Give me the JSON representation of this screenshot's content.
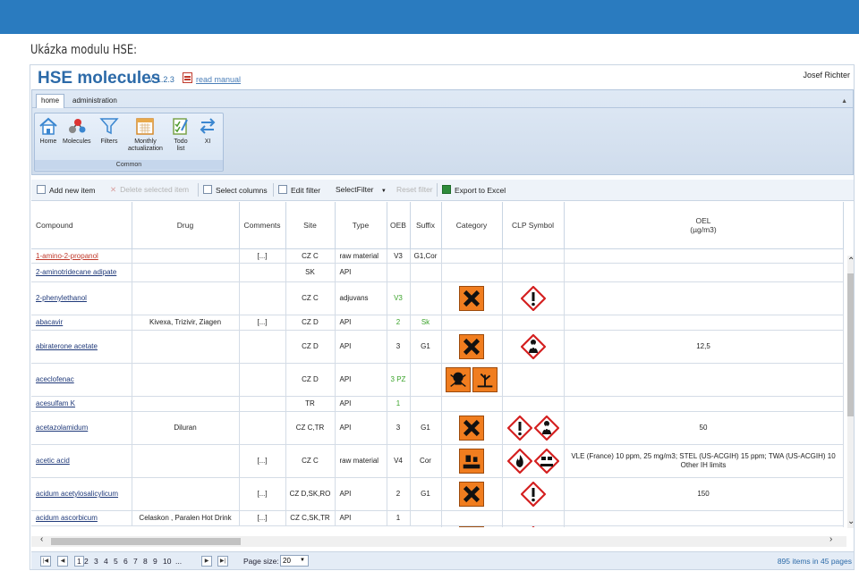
{
  "caption": "Ukázka modulu HSE:",
  "app": {
    "title": "HSE molecules",
    "version": "v. 1.2.3",
    "manual": "read manual",
    "user": "Josef Richter"
  },
  "ribbon": {
    "tabs": [
      "home",
      "administration"
    ],
    "group_label": "Common",
    "buttons": {
      "home": "Home",
      "molecules": "Molecules",
      "filters": "Filters",
      "monthly1": "Monthly",
      "monthly2": "actualization",
      "todo1": "Todo",
      "todo2": "list",
      "xi": "XI"
    }
  },
  "toolbar": {
    "add": "Add new item",
    "delete": "Delete selected item",
    "columns": "Select columns",
    "edit_filter": "Edit filter",
    "select_filter": "SelectFilter",
    "reset": "Reset filter",
    "export": "Export to Excel"
  },
  "columns": [
    "Compound",
    "Drug",
    "Comments",
    "Site",
    "Type",
    "OEB",
    "Suffix",
    "Category",
    "CLP Symbol",
    "OEL",
    "(µg/m3)"
  ],
  "rows": [
    {
      "compound": "1-amino-2-propanol",
      "drug": "",
      "comments": "[...]",
      "site": "CZ C",
      "type": "raw material",
      "oeb": "V3",
      "suffix": "G1,Cor",
      "oel": ""
    },
    {
      "compound": "2-aminotridecane adipate",
      "drug": "",
      "comments": "",
      "site": "SK",
      "type": "API",
      "oeb": "",
      "suffix": "",
      "oel": ""
    },
    {
      "compound": "2-phenylethanol",
      "drug": "",
      "comments": "",
      "site": "CZ C",
      "type": "adjuvans",
      "oeb": "V3",
      "suffix": "",
      "oel": ""
    },
    {
      "compound": "abacavir",
      "drug": "Kivexa, Trizivir, Ziagen",
      "comments": "[...]",
      "site": "CZ D",
      "type": "API",
      "oeb": "2",
      "suffix": "Sk",
      "oel": ""
    },
    {
      "compound": "abiraterone acetate",
      "drug": "",
      "comments": "",
      "site": "CZ D",
      "type": "API",
      "oeb": "3",
      "suffix": "G1",
      "oel": "12,5"
    },
    {
      "compound": "aceclofenac",
      "drug": "",
      "comments": "",
      "site": "CZ D",
      "type": "API",
      "oeb": "3 PZ",
      "suffix": "",
      "oel": ""
    },
    {
      "compound": "acesulfam K",
      "drug": "",
      "comments": "",
      "site": "TR",
      "type": "API",
      "oeb": "1",
      "suffix": "",
      "oel": ""
    },
    {
      "compound": "acetazolamidum",
      "drug": "Diluran",
      "comments": "",
      "site": "CZ C,TR",
      "type": "API",
      "oeb": "3",
      "suffix": "G1",
      "oel": "50"
    },
    {
      "compound": "acetic acid",
      "drug": "",
      "comments": "[...]",
      "site": "CZ C",
      "type": "raw material",
      "oeb": "V4",
      "suffix": "Cor",
      "oel": "VLE (France) 10 ppm, 25 mg/m3; STEL (US-ACGIH) 15 ppm; TWA (US-ACGIH) 10 Other IH limits"
    },
    {
      "compound": "acidum acetylosalicylicum",
      "drug": "",
      "comments": "[...]",
      "site": "CZ D,SK,RO",
      "type": "API",
      "oeb": "2",
      "suffix": "G1",
      "oel": "150"
    },
    {
      "compound": "acidum ascorbicum",
      "drug": "Celaskon , Paralen Hot Drink",
      "comments": "[...]",
      "site": "CZ C,SK,TR",
      "type": "API",
      "oeb": "1",
      "suffix": "",
      "oel": ""
    }
  ],
  "pager": {
    "pages": [
      "1",
      "2",
      "3",
      "4",
      "5",
      "6",
      "7",
      "8",
      "9",
      "10",
      "..."
    ],
    "page_size_label": "Page size:",
    "page_size": "20",
    "info": "895 items in 45 pages"
  },
  "colors": {
    "topbar": "#2a7bbf",
    "title": "#2c6aa8",
    "hazard_orange": "#f07d1f",
    "ghs_red": "#d42020"
  }
}
